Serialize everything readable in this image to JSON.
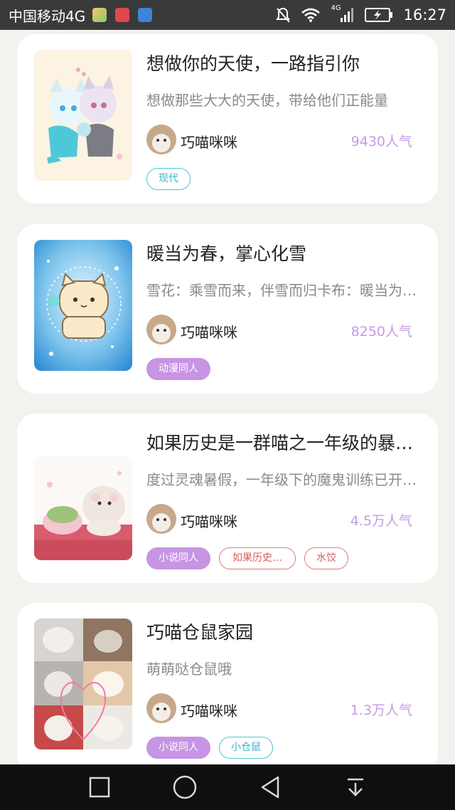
{
  "status_bar": {
    "carrier": "中国移动4G",
    "network_badge": "4G",
    "time": "16:27",
    "icons": [
      "app-icon-1",
      "app-icon-2",
      "app-icon-3",
      "mute-icon",
      "wifi-icon",
      "signal-icon",
      "battery-icon"
    ]
  },
  "cards": [
    {
      "title": "想做你的天使，一路指引你",
      "desc": "想做那些大大的天使，带给他们正能量",
      "author": "巧喵咪咪",
      "popularity": "9430人气",
      "tags": [
        {
          "label": "现代",
          "style": "outline-cyan"
        }
      ]
    },
    {
      "title": "暖当为春，掌心化雪",
      "desc": "雪花：乘雪而来，伴雪而归卡布：暖当为…",
      "author": "巧喵咪咪",
      "popularity": "8250人气",
      "tags": [
        {
          "label": "动漫同人",
          "style": "fill-purple"
        }
      ]
    },
    {
      "title": "如果历史是一群喵之一年级的暴…",
      "desc": "度过灵魂暑假，一年级下的魔鬼训练已开…",
      "author": "巧喵咪咪",
      "popularity": "4.5万人气",
      "tags": [
        {
          "label": "小说同人",
          "style": "fill-purple"
        },
        {
          "label": "如果历史…",
          "style": "outline-red"
        },
        {
          "label": "水饺",
          "style": "outline-red"
        }
      ]
    },
    {
      "title": "巧喵仓鼠家园",
      "desc": "萌萌哒仓鼠哦",
      "author": "巧喵咪咪",
      "popularity": "1.3万人气",
      "tags": [
        {
          "label": "小说同人",
          "style": "fill-purple"
        },
        {
          "label": "小仓鼠",
          "style": "outline-cyan"
        }
      ]
    }
  ],
  "nav_bar": {
    "buttons": [
      "recent-apps-button",
      "home-button",
      "back-button",
      "notification-pull-button"
    ]
  }
}
